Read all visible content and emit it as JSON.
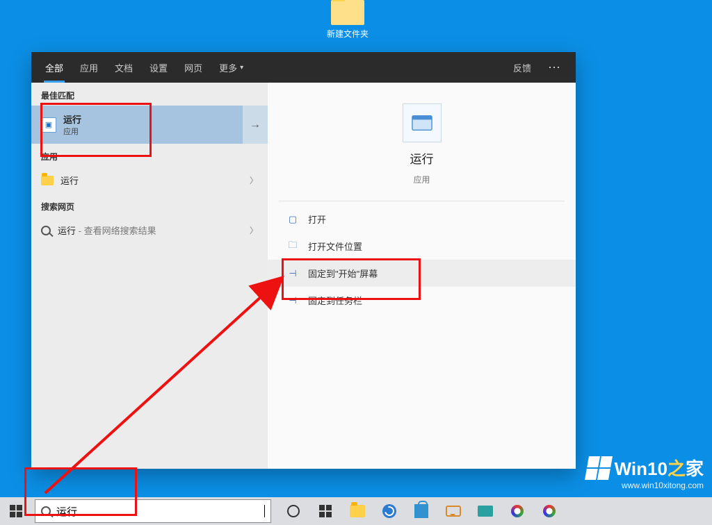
{
  "desktop": {
    "folder_label": "新建文件夹"
  },
  "tabs": {
    "all": "全部",
    "apps": "应用",
    "docs": "文档",
    "settings": "设置",
    "web": "网页",
    "more": "更多",
    "feedback": "反馈"
  },
  "left": {
    "best_match_label": "最佳匹配",
    "run_name": "运行",
    "run_type": "应用",
    "apps_label": "应用",
    "app_run": "运行",
    "web_label": "搜索网页",
    "web_run_prefix": "运行",
    "web_run_suffix": " - 查看网络搜索结果"
  },
  "detail": {
    "title": "运行",
    "subtitle": "应用",
    "actions": {
      "open": "打开",
      "open_location": "打开文件位置",
      "pin_start": "固定到\"开始\"屏幕",
      "pin_taskbar": "固定到任务栏"
    }
  },
  "taskbar": {
    "search_value": "运行"
  },
  "watermark": {
    "brand_prefix": "Win10",
    "brand_mid": "之",
    "brand_suffix": "家",
    "url": "www.win10xitong.com"
  }
}
